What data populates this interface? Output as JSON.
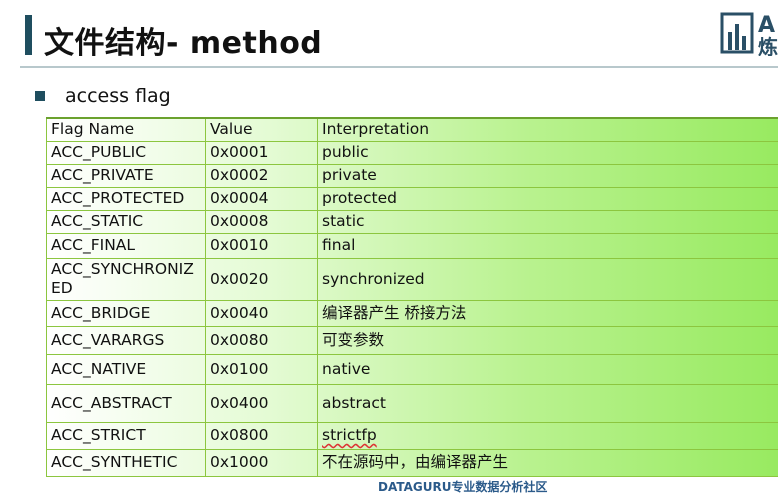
{
  "slide": {
    "title": "文件结构- method",
    "bullet": "access flag",
    "footer": "DATAGURU专业数据分析社区",
    "logo_text": "A 炼"
  },
  "table": {
    "headers": [
      "Flag Name",
      "Value",
      "Interpretation"
    ],
    "rows": [
      {
        "name": "ACC_PUBLIC",
        "value": "0x0001",
        "interp": "public"
      },
      {
        "name": "ACC_PRIVATE",
        "value": "0x0002",
        "interp": "private"
      },
      {
        "name": "ACC_PROTECTED",
        "value": "0x0004",
        "interp": "protected"
      },
      {
        "name": "ACC_STATIC",
        "value": "0x0008",
        "interp": "static"
      },
      {
        "name": "ACC_FINAL",
        "value": "0x0010",
        "interp": "final"
      },
      {
        "name": "ACC_SYNCHRONIZED",
        "value": "0x0020",
        "interp": "synchronized"
      },
      {
        "name": "ACC_BRIDGE",
        "value": "0x0040",
        "interp": "编译器产生 桥接方法"
      },
      {
        "name": "ACC_VARARGS",
        "value": "0x0080",
        "interp": "可变参数"
      },
      {
        "name": "ACC_NATIVE",
        "value": "0x0100",
        "interp": "native"
      },
      {
        "name": "ACC_ABSTRACT",
        "value": "0x0400",
        "interp": "abstract"
      },
      {
        "name": "ACC_STRICT",
        "value": "0x0800",
        "interp": "strictfp"
      },
      {
        "name": "ACC_SYNTHETIC",
        "value": "0x1000",
        "interp": "不在源码中，由编译器产生"
      }
    ]
  },
  "colors": {
    "accent_bar": "#1f4e5f",
    "table_border": "#8cc63f",
    "table_green": "#97ea5f"
  }
}
